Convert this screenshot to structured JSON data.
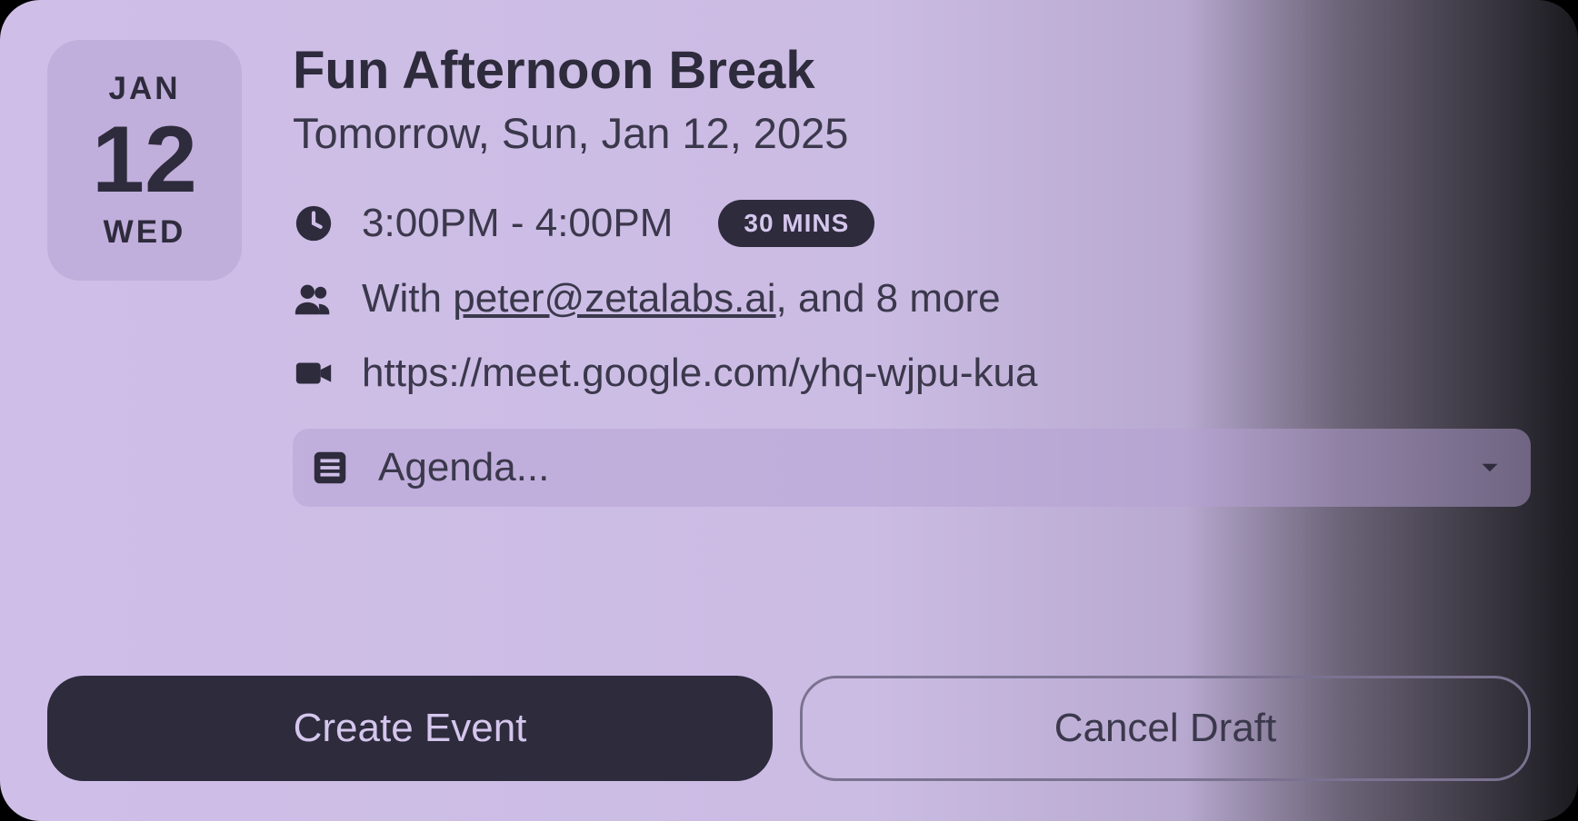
{
  "date": {
    "month": "JAN",
    "day": "12",
    "dow": "WED"
  },
  "event": {
    "title": "Fun Afternoon Break",
    "subtitle": "Tomorrow, Sun, Jan 12, 2025",
    "time": "3:00PM - 4:00PM",
    "duration_pill": "30 MINS",
    "attendees_prefix": "With ",
    "attendees_email": "peter@zetalabs.ai",
    "attendees_suffix": ", and 8 more",
    "meeting_link": "https://meet.google.com/yhq-wjpu-kua",
    "agenda_placeholder": "Agenda..."
  },
  "buttons": {
    "create": "Create Event",
    "cancel": "Cancel Draft"
  }
}
